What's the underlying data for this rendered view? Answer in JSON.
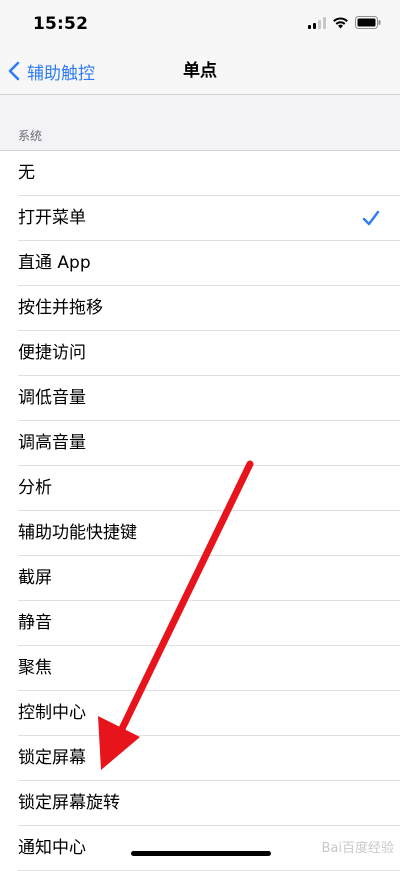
{
  "status_bar": {
    "time": "15:52"
  },
  "nav": {
    "back_label": "辅助触控",
    "title": "单点"
  },
  "section": {
    "header": "系统"
  },
  "items": [
    {
      "label": "无",
      "selected": false
    },
    {
      "label": "打开菜单",
      "selected": true
    },
    {
      "label": "直通 App",
      "selected": false
    },
    {
      "label": "按住并拖移",
      "selected": false
    },
    {
      "label": "便捷访问",
      "selected": false
    },
    {
      "label": "调低音量",
      "selected": false
    },
    {
      "label": "调高音量",
      "selected": false
    },
    {
      "label": "分析",
      "selected": false
    },
    {
      "label": "辅助功能快捷键",
      "selected": false
    },
    {
      "label": "截屏",
      "selected": false
    },
    {
      "label": "静音",
      "selected": false
    },
    {
      "label": "聚焦",
      "selected": false
    },
    {
      "label": "控制中心",
      "selected": false
    },
    {
      "label": "锁定屏幕",
      "selected": false
    },
    {
      "label": "锁定屏幕旋转",
      "selected": false
    },
    {
      "label": "通知中心",
      "selected": false
    }
  ],
  "accent_color": "#2f7cf6",
  "annotation": {
    "arrow_color": "#e8141c",
    "points_to": "锁定屏幕"
  },
  "watermark": "Bai百度经验"
}
